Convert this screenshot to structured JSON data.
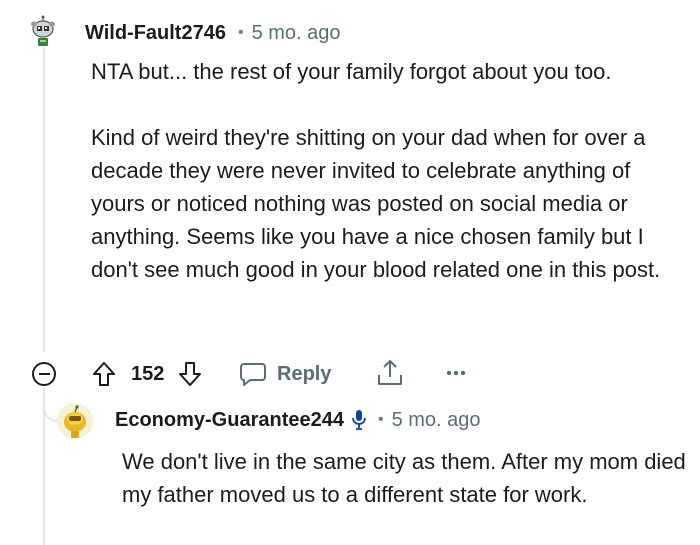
{
  "comment": {
    "username": "Wild-Fault2746",
    "separator": "•",
    "timestamp": "5 mo. ago",
    "avatar_icon": "robot-snoo-avatar-icon",
    "paragraphs": [
      "NTA but... the rest of your family forgot about you too.",
      "Kind of weird they're shitting on your dad when for over a decade they were never invited to celebrate anything of yours or noticed nothing was posted on social media or anything. Seems like you have a nice chosen family but I don't see much good in your blood related one in this post."
    ],
    "actions": {
      "upvote_icon": "arrow-up-icon",
      "score": "152",
      "downvote_icon": "arrow-down-icon",
      "reply_label": "Reply",
      "share_icon": "share-icon",
      "more_icon": "ellipsis-icon",
      "collapse_icon": "minus-circle-icon"
    }
  },
  "reply": {
    "username": "Economy-Guarantee244",
    "badge_icon": "microphone-icon",
    "separator": "•",
    "timestamp": "5 mo. ago",
    "avatar_icon": "yellow-snoo-avatar-icon",
    "text": "We don't live in the same city as them. After my mom died my father moved us to a different state for work."
  },
  "colors": {
    "text": "#1c1c1c",
    "meta": "#576f76",
    "thread_line": "#e5e5e5",
    "mic_badge": "#0a449b"
  }
}
